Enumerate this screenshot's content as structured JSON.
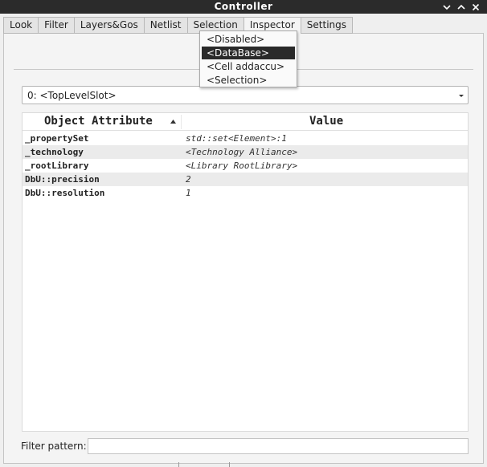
{
  "window": {
    "title": "Controller",
    "controls": [
      "chevron-down-icon",
      "chevron-up-icon",
      "close-icon"
    ]
  },
  "tabs": [
    {
      "label": "Look"
    },
    {
      "label": "Filter"
    },
    {
      "label": "Layers&Gos"
    },
    {
      "label": "Netlist"
    },
    {
      "label": "Selection"
    },
    {
      "label": "Inspector",
      "active": true
    },
    {
      "label": "Settings"
    }
  ],
  "dropdown": {
    "items": [
      "<Disabled>",
      "<DataBase>",
      "<Cell addaccu>",
      "<Selection>"
    ],
    "selected": "<DataBase>"
  },
  "slot_select": {
    "value": "0: <TopLevelSlot>"
  },
  "table": {
    "columns": [
      "Object Attribute",
      "Value"
    ],
    "rows": [
      {
        "attr": "_propertySet",
        "value": "std::set<Element>:1"
      },
      {
        "attr": "_technology",
        "value": "<Technology Alliance>"
      },
      {
        "attr": "_rootLibrary",
        "value": "<Library RootLibrary>"
      },
      {
        "attr": "DbU::precision",
        "value": "2"
      },
      {
        "attr": "DbU::resolution",
        "value": "1"
      }
    ]
  },
  "filter": {
    "label": "Filter pattern:",
    "value": ""
  }
}
